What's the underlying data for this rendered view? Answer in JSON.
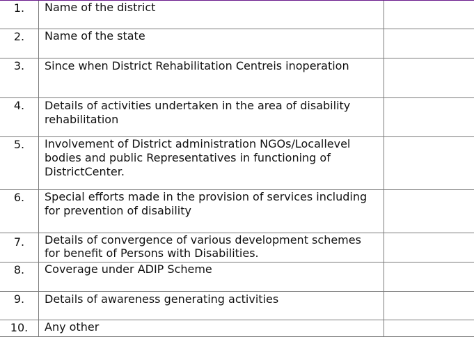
{
  "rows": [
    {
      "num": "1.",
      "text": "Name of the district",
      "value": ""
    },
    {
      "num": "2.",
      "text": "Name of the state",
      "value": ""
    },
    {
      "num": "3.",
      "text": "Since when District Rehabilitation Centreis inoperation",
      "value": ""
    },
    {
      "num": "4.",
      "text": "Details of activities undertaken in the area of disability rehabilitation",
      "value": ""
    },
    {
      "num": "5.",
      "text": "Involvement of District administration NGOs/Locallevel bodies and public Representatives in functioning of DistrictCenter.",
      "value": ""
    },
    {
      "num": "6.",
      "text": "Special efforts made in the provision of services including for prevention of disability",
      "value": ""
    },
    {
      "num": "7.",
      "text": "Details of convergence of various development schemes for benefit of Persons with Disabilities.",
      "value": ""
    },
    {
      "num": "8.",
      "text": "Coverage under ADIP Scheme",
      "value": ""
    },
    {
      "num": "9.",
      "text": "Details of awareness generating activities",
      "value": ""
    },
    {
      "num": "10.",
      "text": "Any other",
      "value": ""
    }
  ]
}
